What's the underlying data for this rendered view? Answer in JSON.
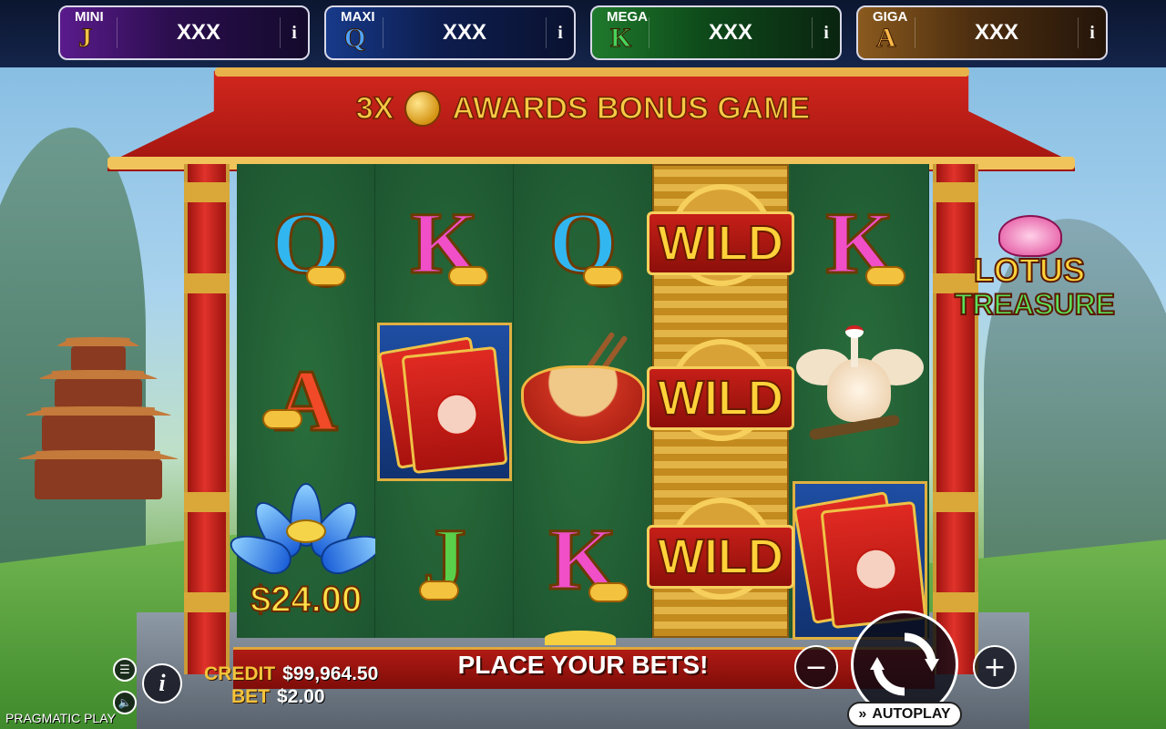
{
  "jackpots": [
    {
      "name": "MINI",
      "letter": "J",
      "value": "XXX",
      "info": "i"
    },
    {
      "name": "MAXI",
      "letter": "Q",
      "value": "XXX",
      "info": "i"
    },
    {
      "name": "MEGA",
      "letter": "K",
      "value": "XXX",
      "info": "i"
    },
    {
      "name": "GIGA",
      "letter": "A",
      "value": "XXX",
      "info": "i"
    }
  ],
  "banner": {
    "multiplier": "3X",
    "text": "AWARDS BONUS GAME"
  },
  "logo": {
    "line1": "LOTUS",
    "line2": "TREASURE"
  },
  "reels": [
    {
      "symbols": [
        "Q",
        "A",
        "lotus"
      ]
    },
    {
      "symbols": [
        "K",
        "red-envelope",
        "J"
      ]
    },
    {
      "symbols": [
        "Q",
        "noodle-bowl",
        "K"
      ]
    },
    {
      "symbols": [
        "WILD",
        "WILD",
        "WILD"
      ]
    },
    {
      "symbols": [
        "K",
        "crane",
        "red-envelope"
      ]
    }
  ],
  "wild_label": "WILD",
  "lotus_value": "$24.00",
  "status": {
    "message": "PLACE YOUR BETS!"
  },
  "credit": {
    "label": "CREDIT",
    "value": "$99,964.50"
  },
  "bet": {
    "label": "BET",
    "value": "$2.00"
  },
  "controls": {
    "menu_icon": "menu-icon",
    "sound_icon": "speaker-icon",
    "info_label": "i",
    "minus_label": "−",
    "plus_label": "+",
    "spin_icon": "spin-arrows-icon",
    "autoplay_label": "AUTOPLAY"
  },
  "brand": "PRAGMATIC PLAY",
  "colors": {
    "frame_red": "#d2271e",
    "gold": "#f6c43a",
    "reel_green": "#1f5c30"
  }
}
